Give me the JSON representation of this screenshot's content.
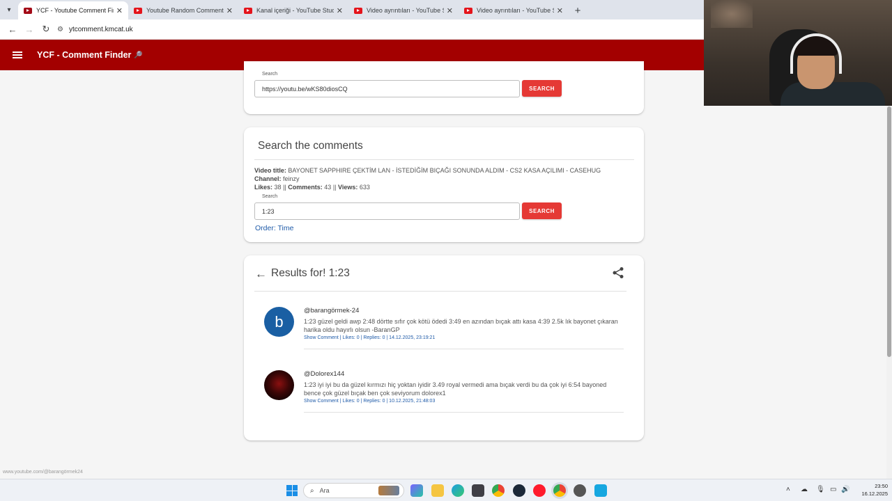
{
  "browser": {
    "tabs": [
      {
        "title": "YCF - Youtube Comment Finder",
        "active": true,
        "icon": "ycf-favicon"
      },
      {
        "title": "Youtube Random Comment Picker",
        "active": false,
        "icon": "youtube-favicon"
      },
      {
        "title": "Kanal içeriği - YouTube Studio",
        "active": false,
        "icon": "youtube-favicon"
      },
      {
        "title": "Video ayrıntıları - YouTube Studio",
        "active": false,
        "icon": "youtube-favicon"
      },
      {
        "title": "Video ayrıntıları - YouTube Studio",
        "active": false,
        "icon": "youtube-favicon"
      }
    ],
    "url": "ytcomment.kmcat.uk",
    "status_url": "www.youtube.com/@barangörmek24"
  },
  "appbar": {
    "title": "YCF - Comment Finder",
    "title_icon": "🔎"
  },
  "video_search": {
    "label": "Search",
    "value": "https://youtu.be/wKS80diosCQ",
    "button": "SEARCH"
  },
  "comment_search": {
    "heading": "Search the comments",
    "video_title_label": "Video title:",
    "video_title": "BAYONET SAPPHIRE ÇEKTİM LAN - İSTEDİĞİM BIÇAĞI SONUNDA ALDIM - CS2 KASA AÇILIMI - CASEHUG",
    "channel_label": "Channel:",
    "channel": "feinzy",
    "likes_label": "Likes:",
    "likes": "38",
    "comments_label": "Comments:",
    "comments": "43",
    "views_label": "Views:",
    "views": "633",
    "sep": "||",
    "search_label": "Search",
    "search_value": "1:23",
    "button": "SEARCH",
    "order": "Order: Time"
  },
  "results": {
    "title": "Results for! 1:23",
    "items": [
      {
        "avatar_letter": "b",
        "user": "@barangörmek-24",
        "text": "1:23 güzel geldi awp 2:48 dörtte sıfır çok kötü ödedi 3:49 en azından bıçak attı kasa 4:39 2.5k lık bayonet çıkaran harika oldu hayırlı olsun -BaranGP",
        "meta": "Show Comment | Likes: 0 | Replies: 0 | 14.12.2025, 23:19:21"
      },
      {
        "avatar_letter": "",
        "user": "@Dolorex144",
        "text": "1:23 iyi iyi bu da güzel kırmızı hiç yoktan iyidir 3.49 royal vermedi ama bıçak verdi bu da çok iyi 6:54 bayoned bence çok güzel bıçak ben çok seviyorum dolorex1",
        "meta": "Show Comment | Likes: 0 | Replies: 0 | 10.12.2025, 21:48:03"
      }
    ]
  },
  "taskbar": {
    "search_placeholder": "Ara",
    "time": "23:50",
    "date": "16.12.2025"
  },
  "colors": {
    "appbar": "#a30000",
    "button": "#e53935",
    "link": "#1e5aa8",
    "avatar": "#1a5fa3"
  }
}
